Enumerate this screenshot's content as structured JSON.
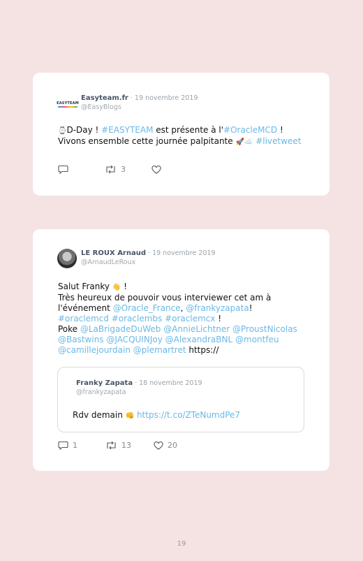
{
  "tweet1": {
    "author": "Easyteam.fr",
    "date": " · 19 novembre 2019",
    "handle": "@EasyBlogs",
    "logo_text": "EASYTEAM",
    "line1": {
      "icon": "⌚",
      "a": "D-Day ! ",
      "b": "#EASYTEAM",
      "c": " est présente à l'",
      "d": "#OracleMCD",
      "e": " !"
    },
    "line2": {
      "a": "Vivons ensemble cette journée palpitante ",
      "emoji1": "🚀",
      "emoji2": "☁️",
      "space": " ",
      "b": "#livetweet"
    },
    "retweets": "3"
  },
  "tweet2": {
    "author": "LE ROUX Arnaud",
    "date": " · 19 novembre 2019",
    "handle": "@ArnaudLeRoux",
    "l1": {
      "a": "Salut Franky ",
      "emoji": "👋",
      "b": " !"
    },
    "l2": "Très heureux de pouvoir vous interviewer cet am à",
    "l3": {
      "a": "l'événement ",
      "b": "@Oracle_France",
      "c": ", ",
      "d": "@frankyzapata",
      "e": "!"
    },
    "l4": {
      "a": "#oraclemcd #oraclembs #oraclemcx",
      "b": " !"
    },
    "l5": {
      "a": "Poke ",
      "b": "@LaBrigadeDuWeb @AnnieLichtner @ProustNicolas"
    },
    "l6": "@Bastwins @JACQUINJoy @AlexandraBNL @montfeu",
    "l7": {
      "a": "@camillejourdain @plemartret",
      "b": " https://"
    },
    "replies": "1",
    "retweets": "13",
    "likes": "20",
    "quote": {
      "author": "Franky Zapata",
      "date": " · 18 novembre 2019",
      "handle": "@frankyzapata",
      "text": "Rdv demain ",
      "emoji": "👊",
      "link": " https://t.co/ZTeNumdPe7"
    }
  },
  "page_number": "19"
}
